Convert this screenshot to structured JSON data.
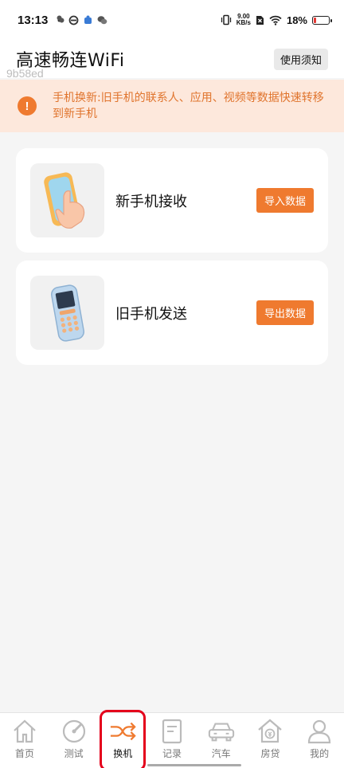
{
  "status": {
    "time": "13:13",
    "net_speed": "9.00",
    "net_unit": "KB/s",
    "battery": "18%",
    "battery_level": 0.18
  },
  "header": {
    "title": "高速畅连WiFi",
    "notice_label": "使用须知",
    "watermark": "9b58ed"
  },
  "banner": {
    "icon": "!",
    "text": "手机换新:旧手机的联系人、应用、视频等数据快速转移到新手机"
  },
  "cards": [
    {
      "title": "新手机接收",
      "button": "导入数据",
      "icon": "tablet-hand-icon"
    },
    {
      "title": "旧手机发送",
      "button": "导出数据",
      "icon": "feature-phone-icon"
    }
  ],
  "tabs": [
    {
      "label": "首页",
      "icon": "house-icon"
    },
    {
      "label": "测试",
      "icon": "gauge-icon"
    },
    {
      "label": "换机",
      "icon": "swap-arrows-icon",
      "active": true
    },
    {
      "label": "记录",
      "icon": "document-icon"
    },
    {
      "label": "汽车",
      "icon": "car-icon"
    },
    {
      "label": "房贷",
      "icon": "house-coin-icon"
    },
    {
      "label": "我的",
      "icon": "user-icon"
    }
  ],
  "colors": {
    "accent": "#ef7a2f",
    "banner_bg": "#fde8dc",
    "highlight": "#e4001b"
  }
}
